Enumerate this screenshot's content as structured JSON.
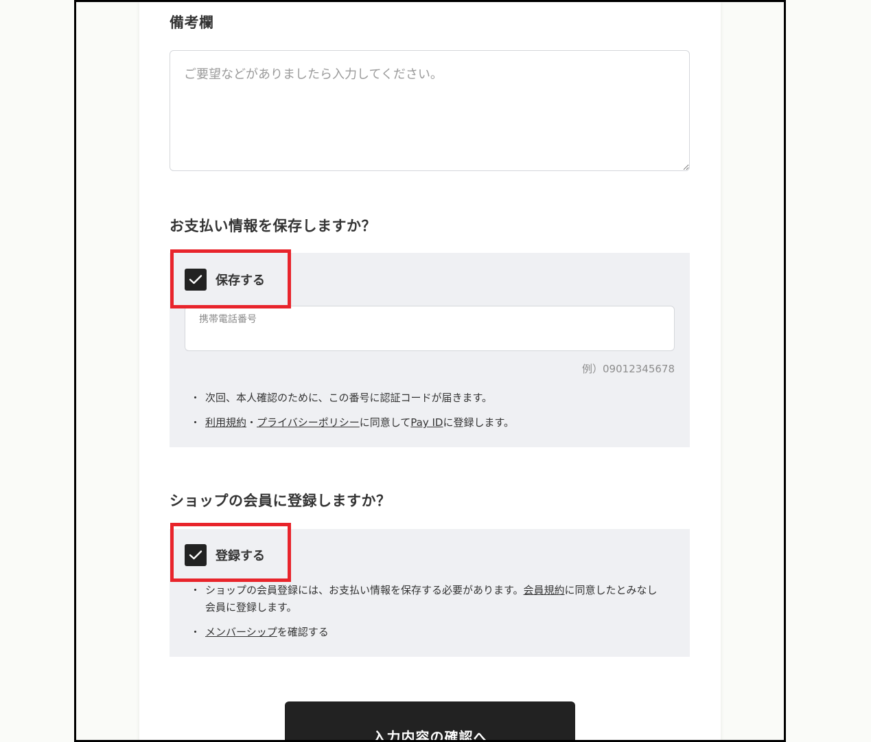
{
  "remarks": {
    "title": "備考欄",
    "placeholder": "ご要望などがありましたら入力してください。"
  },
  "payment": {
    "question": "お支払い情報を保存しますか？",
    "checkbox_label": "保存する",
    "checked": true,
    "phone_label": "携帯電話番号",
    "phone_example": "例）09012345678",
    "note1": "次回、本人確認のために、この番号に認証コードが届きます。",
    "note2_link1": "利用規約",
    "note2_sep": "・",
    "note2_link2": "プライバシーポリシー",
    "note2_mid": "に同意して",
    "note2_link3": "Pay ID",
    "note2_end": "に登録します。"
  },
  "membership": {
    "question": "ショップの会員に登録しますか？",
    "checkbox_label": "登録する",
    "checked": true,
    "note1_pre": "ショップの会員登録には、お支払い情報を保存する必要があります。",
    "note1_link": "会員規約",
    "note1_post": "に同意したとみなし会員に登録します。",
    "note2_link": "メンバーシップ",
    "note2_post": "を確認する"
  },
  "submit_label": "入力内容の確認へ",
  "colors": {
    "highlight": "#e8242b",
    "checkbox": "#222222",
    "panel": "#eff0f3",
    "button": "#222222"
  }
}
